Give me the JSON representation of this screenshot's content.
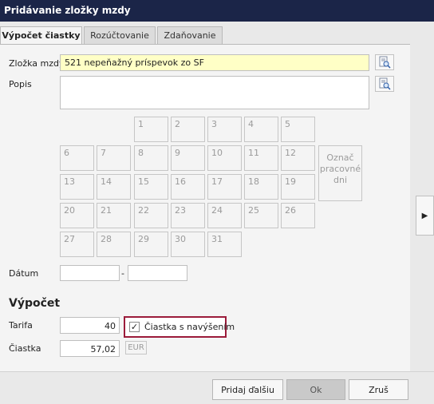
{
  "window": {
    "title": "Pridávanie zložky mzdy"
  },
  "tabs": [
    {
      "label": "Výpočet čiastky",
      "active": true
    },
    {
      "label": "Rozúčtovanie",
      "active": false
    },
    {
      "label": "Zdaňovanie",
      "active": false
    }
  ],
  "form": {
    "zlozka_label": "Zložka mzdy",
    "zlozka_value": "521  nepeňažný príspevok zo SF",
    "popis_label": "Popis",
    "popis_value": "",
    "datum_label": "Dátum",
    "datum_from": "",
    "datum_to": "",
    "datum_separator": "-"
  },
  "calendar": {
    "days": [
      "1",
      "2",
      "3",
      "4",
      "5",
      "6",
      "7",
      "8",
      "9",
      "10",
      "11",
      "12",
      "13",
      "14",
      "15",
      "16",
      "17",
      "18",
      "19",
      "20",
      "21",
      "22",
      "23",
      "24",
      "25",
      "26",
      "27",
      "28",
      "29",
      "30",
      "31"
    ],
    "mark_button_label": "Označ pracovné dni"
  },
  "vypocet": {
    "title": "Výpočet",
    "tarifa_label": "Tarifa",
    "tarifa_value": "40",
    "ciastka_label": "Čiastka",
    "ciastka_value": "57,02",
    "currency": "EUR",
    "checkbox_label": "Čiastka s navýšením",
    "checkbox_checked": true
  },
  "footer": {
    "add_next_label": "Pridaj ďalšiu",
    "ok_label": "Ok",
    "cancel_label": "Zruš"
  },
  "colors": {
    "titlebar": "#1b2548",
    "highlight": "#9b1b3a",
    "field_yellow": "#ffffc6"
  }
}
